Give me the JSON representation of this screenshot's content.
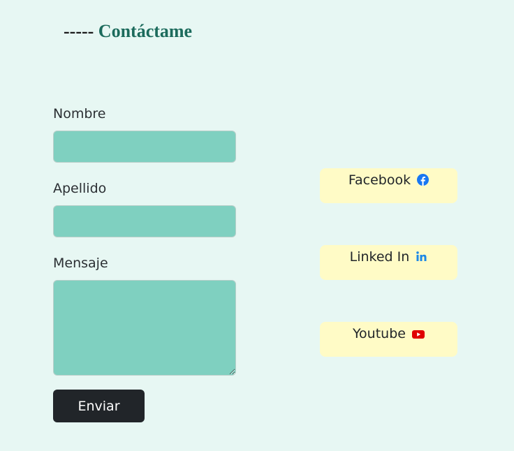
{
  "header": {
    "dashes": "-----",
    "title": "Contáctame"
  },
  "form": {
    "fields": [
      {
        "label": "Nombre",
        "value": ""
      },
      {
        "label": "Apellido",
        "value": ""
      },
      {
        "label": "Mensaje",
        "value": ""
      }
    ],
    "submit_label": "Enviar"
  },
  "social": [
    {
      "label": "Facebook",
      "icon": "facebook-icon",
      "color": "#1877f2"
    },
    {
      "label": "Linked In",
      "icon": "linkedin-icon",
      "color": "#0a66c2"
    },
    {
      "label": "Youtube",
      "icon": "youtube-icon",
      "color": "#ff0000"
    }
  ],
  "colors": {
    "background": "#e7f7f3",
    "heading_accent": "#1c6b5c",
    "input_fill": "#7fd0c0",
    "social_card": "#fffbc6",
    "button": "#212529"
  }
}
